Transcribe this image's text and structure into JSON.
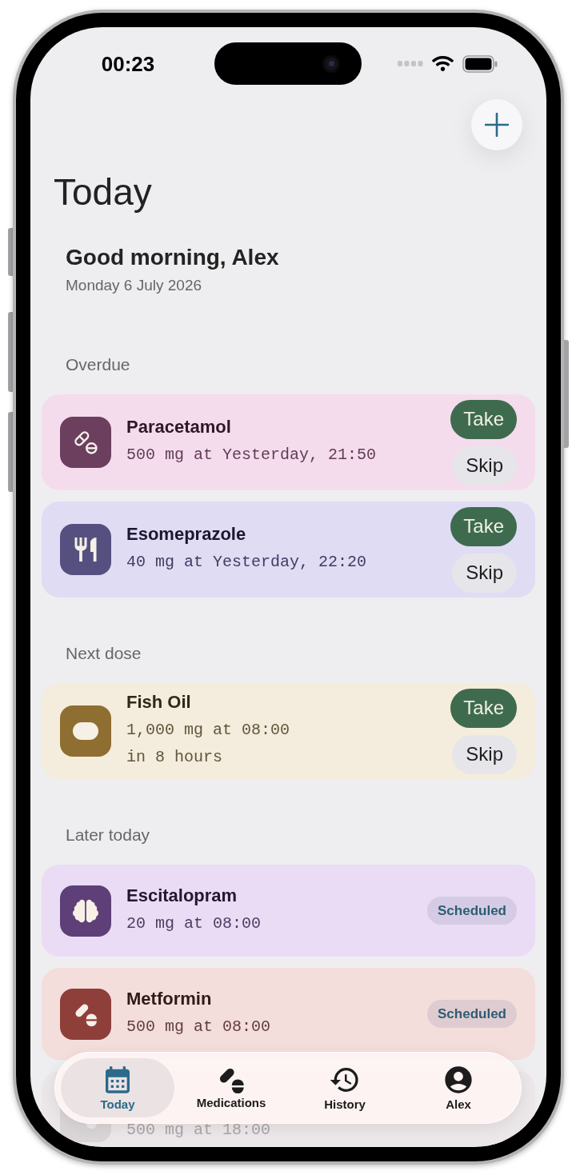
{
  "status_bar": {
    "time": "00:23"
  },
  "header": {
    "title": "Today",
    "greeting": "Good morning, Alex",
    "date": "Monday 6 July 2026"
  },
  "sections": [
    {
      "title": "Overdue",
      "items": [
        {
          "kind": "capsule",
          "color": "#6c3f5e",
          "name": "Paracetamol",
          "details": [
            "500 mg at Yesterday, 21:50"
          ],
          "actions": [
            {
              "label": "Take",
              "kind": "primary"
            },
            {
              "label": "Skip",
              "kind": "secondary"
            }
          ],
          "dimmed": false
        },
        {
          "kind": "meal",
          "color": "#565080",
          "name": "Esomeprazole",
          "details": [
            "40 mg at Yesterday, 22:20"
          ],
          "actions": [
            {
              "label": "Take",
              "kind": "primary"
            },
            {
              "label": "Skip",
              "kind": "secondary"
            }
          ],
          "dimmed": false
        }
      ]
    },
    {
      "title": "Next dose",
      "items": [
        {
          "kind": "softgel",
          "color": "#8f6e32",
          "name": "Fish Oil",
          "details": [
            "1,000 mg at 08:00",
            "in 8 hours"
          ],
          "actions": [
            {
              "label": "Take",
              "kind": "primary"
            },
            {
              "label": "Skip",
              "kind": "secondary"
            }
          ],
          "dimmed": false
        }
      ]
    },
    {
      "title": "Later today",
      "items": [
        {
          "kind": "brain",
          "color": "#5e3f78",
          "name": "Escitalopram",
          "details": [
            "20 mg at 08:00"
          ],
          "status": "Scheduled",
          "dimmed": false
        },
        {
          "kind": "tablet",
          "color": "#8e3f3a",
          "name": "Metformin",
          "details": [
            "500 mg at 08:00"
          ],
          "status": "Scheduled",
          "dimmed": false
        },
        {
          "kind": "tablet",
          "details": [
            "500 mg at 18:00"
          ],
          "dimmed": true
        }
      ]
    }
  ],
  "tabs": [
    {
      "label": "Today",
      "selected": true
    },
    {
      "label": "Medications",
      "selected": false
    },
    {
      "label": "History",
      "selected": false
    },
    {
      "label": "Alex",
      "selected": false
    }
  ]
}
